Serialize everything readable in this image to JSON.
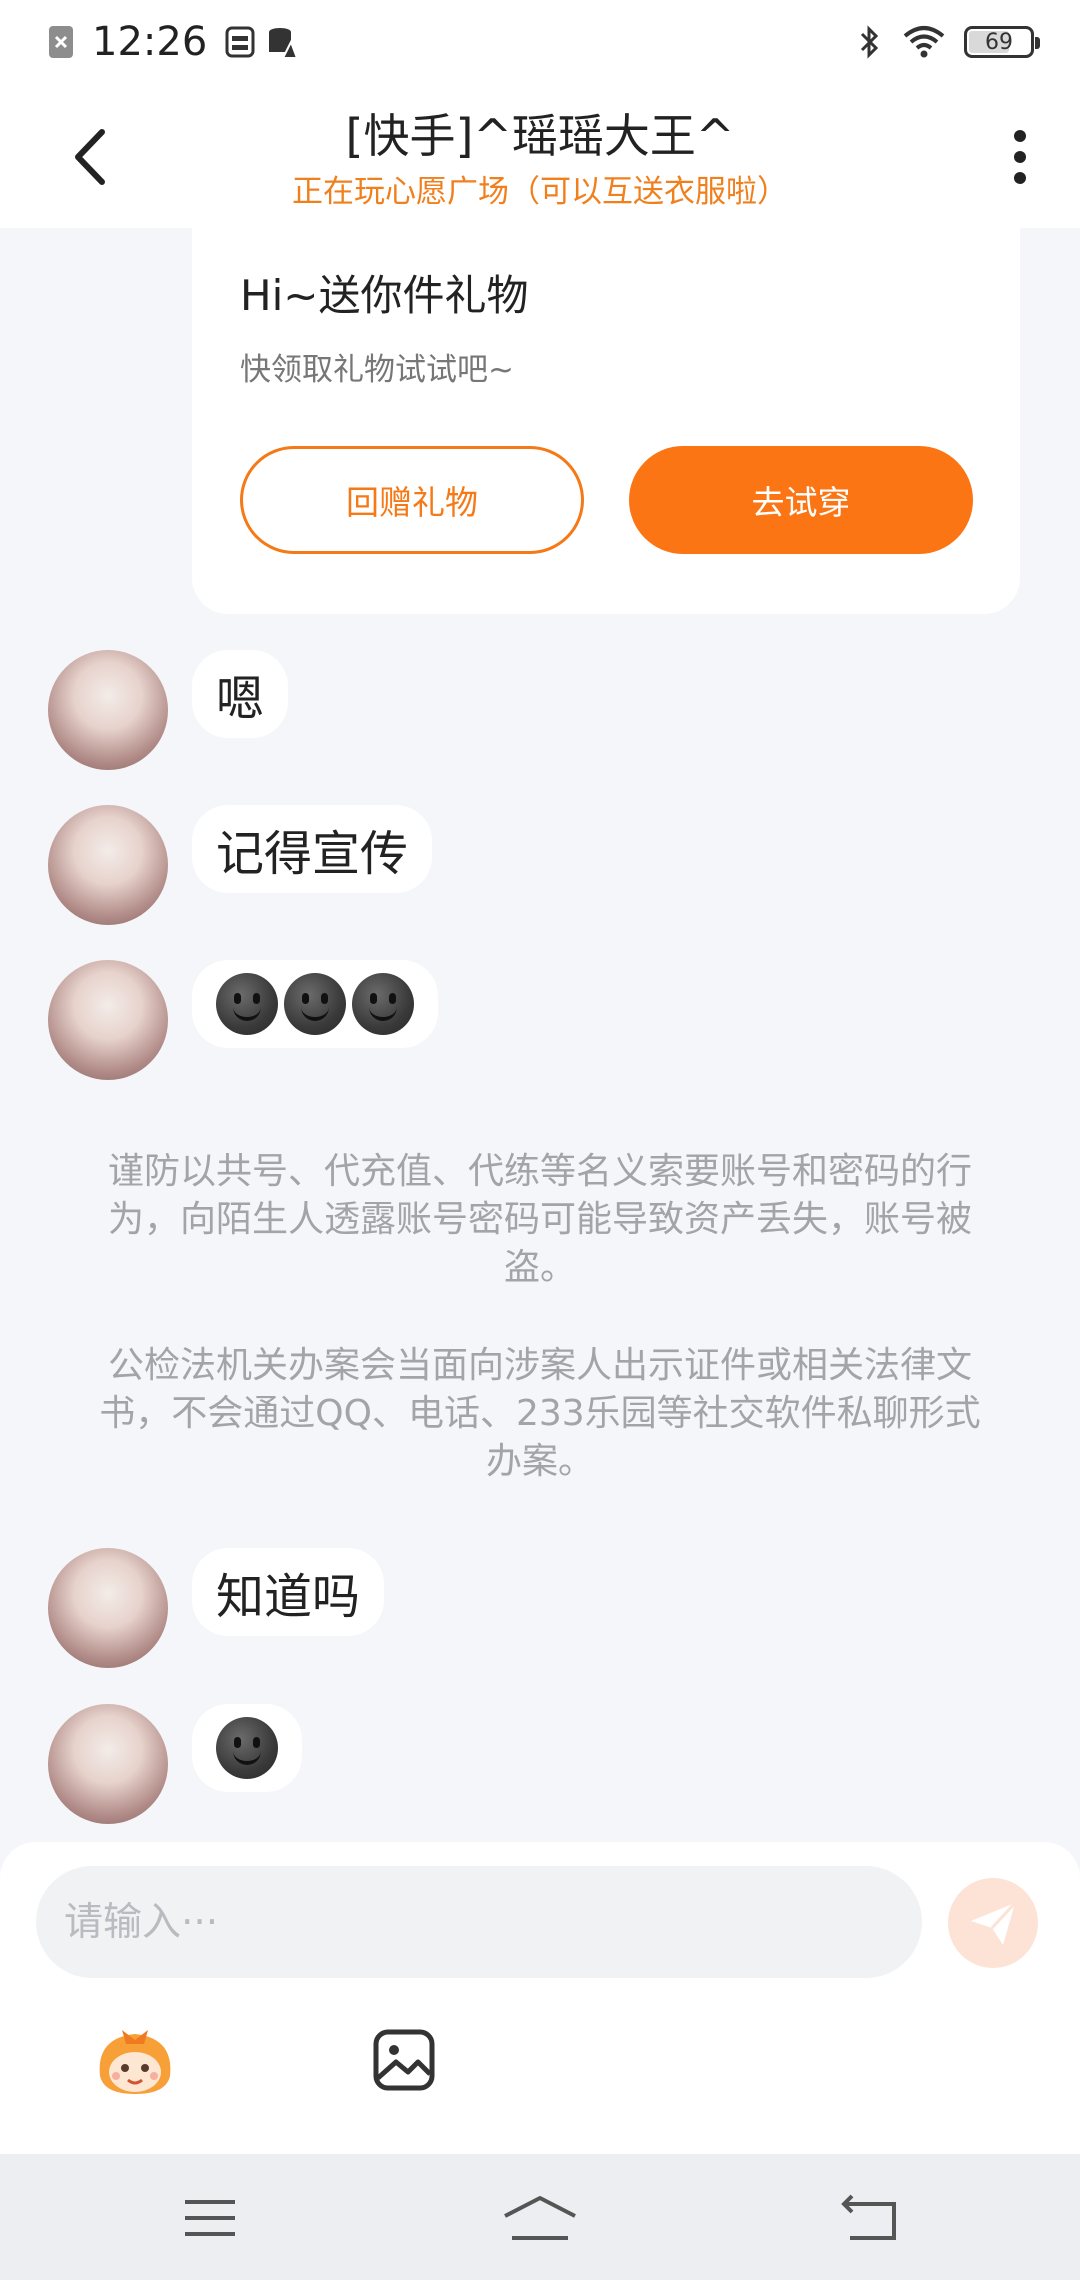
{
  "status_bar": {
    "time": "12:26",
    "battery": "69",
    "icons": [
      "sim-blocked-icon",
      "data-saver-icon",
      "database-alert-icon",
      "bluetooth-icon",
      "wifi-icon",
      "battery-icon"
    ]
  },
  "header": {
    "title": "[快手]^瑶瑶大王^",
    "subtitle": "正在玩心愿广场（可以互送衣服啦）",
    "back_icon": "chevron-left-icon",
    "more_icon": "more-vertical-icon"
  },
  "gift_card": {
    "title": "Hi~送你件礼物",
    "description": "快领取礼物试试吧~",
    "return_gift_label": "回赠礼物",
    "try_on_label": "去试穿",
    "accent_color": "#fb7514"
  },
  "messages": [
    {
      "text": "嗯"
    },
    {
      "text": "记得宣传"
    },
    {
      "emoji_count": 3,
      "emoji": "smiling-face-icon"
    },
    {
      "text": "知道吗"
    },
    {
      "emoji_count": 1,
      "emoji": "smiling-face-icon"
    }
  ],
  "notices": [
    "谨防以共号、代充值、代练等名义索要账号和密码的行为，向陌生人透露账号密码可能导致资产丢失，账号被盗。",
    "公检法机关办案会当面向涉案人出示证件或相关法律文书，不会通过QQ、电话、233乐园等社交软件私聊形式办案。"
  ],
  "composer": {
    "placeholder": "请输入···",
    "send_icon": "send-icon",
    "emoji_icon": "mascot-emoji-icon",
    "image_icon": "image-icon"
  },
  "system_nav": {
    "icons": [
      "menu-icon",
      "home-icon",
      "back-icon"
    ]
  }
}
